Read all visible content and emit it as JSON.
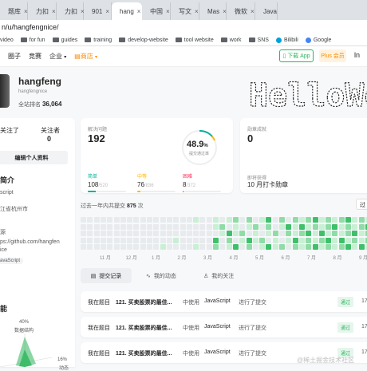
{
  "browser": {
    "tabs": [
      {
        "title": "题库",
        "color": "#ffa116"
      },
      {
        "title": "力扣",
        "color": "#ffa116"
      },
      {
        "title": "力扣",
        "color": "#ffa116"
      },
      {
        "title": "901",
        "color": "#ffa116"
      },
      {
        "title": "hang",
        "color": "#ffa116"
      },
      {
        "title": "中国",
        "color": "#1aad19"
      },
      {
        "title": "写文",
        "color": "#1e80ff"
      },
      {
        "title": "Mas",
        "color": "#fc6d26"
      },
      {
        "title": "微软",
        "color": "#0078d4"
      },
      {
        "title": "Java",
        "color": "#202124"
      }
    ],
    "close_glyph": "×",
    "address": "n/u/hangfengnice/",
    "bookmarks": [
      "video",
      "for fun",
      "guides",
      "training",
      "develop-website",
      "tool website",
      "work",
      "SNS",
      "Bilibili",
      "Google"
    ]
  },
  "site_nav": {
    "items": [
      "圈子",
      "竞赛",
      "企业",
      "商店"
    ],
    "app_button": "下载 App",
    "plus_button": "Plus 会员",
    "avatar_initial": "ln"
  },
  "profile": {
    "name": "hangfeng",
    "handle": "hangfengnice",
    "rank_label": "全站排名",
    "rank_value": "36,064",
    "following_label": "关注了",
    "followers_label": "关注者",
    "followers_value": "0",
    "following_value": "0",
    "edit_button": "编辑个人资料",
    "intro_heading": "简介",
    "language": "script",
    "location": "江省杭州市",
    "skills_heading": "源",
    "github": "ps://github.com/hangfen",
    "github2": "ice",
    "tag": "avaScript",
    "ability_heading": "能",
    "ability_top_pct": "40%",
    "ability_top_label": "数据结构",
    "ability_bottom_pct": "16%",
    "ability_bottom_label": "动态"
  },
  "banner": {
    "text": "HelloWorld"
  },
  "solved": {
    "label": "解决问题",
    "value": "192",
    "rate": "48.9",
    "rate_unit": "%",
    "rate_label": "提交通过率",
    "levels": [
      {
        "name": "简单",
        "solved": "108",
        "total": "/520",
        "color": "#00af9b"
      },
      {
        "name": "中等",
        "solved": "76",
        "total": "/836",
        "color": "#ffb800"
      },
      {
        "name": "困难",
        "solved": "8",
        "total": "/372",
        "color": "#ff2d55"
      }
    ]
  },
  "badges": {
    "label": "勋章成就",
    "value": "0",
    "recent_label": "即将获得",
    "recent_value": "10 月打卡勋章"
  },
  "calendar": {
    "title_prefix": "过去一年内共提交",
    "count": "875",
    "title_suffix": "次",
    "months": [
      "11 月",
      "12 月",
      "1 月",
      "2 月",
      "3 月",
      "4 月",
      "5 月",
      "6 月",
      "7 月",
      "8 月",
      "9 月"
    ],
    "selector": "过"
  },
  "tabs": {
    "items": [
      "提交记录",
      "我的动态",
      "我的关注"
    ]
  },
  "submissions": [
    {
      "prefix": "我在题目",
      "problem": "121. 买卖股票的最佳...",
      "mid": "中使用",
      "lang": "JavaScript",
      "suffix": "进行了提交",
      "status": "通过",
      "time": "17"
    },
    {
      "prefix": "我在题目",
      "problem": "121. 买卖股票的最佳...",
      "mid": "中使用",
      "lang": "JavaScript",
      "suffix": "进行了提交",
      "status": "通过",
      "time": "17"
    },
    {
      "prefix": "我在题目",
      "problem": "121. 买卖股票的最佳...",
      "mid": "中使用",
      "lang": "JavaScript",
      "suffix": "进行了提交",
      "status": "通过",
      "time": "17"
    }
  ],
  "watermark": "@稀土掘金技术社区"
}
